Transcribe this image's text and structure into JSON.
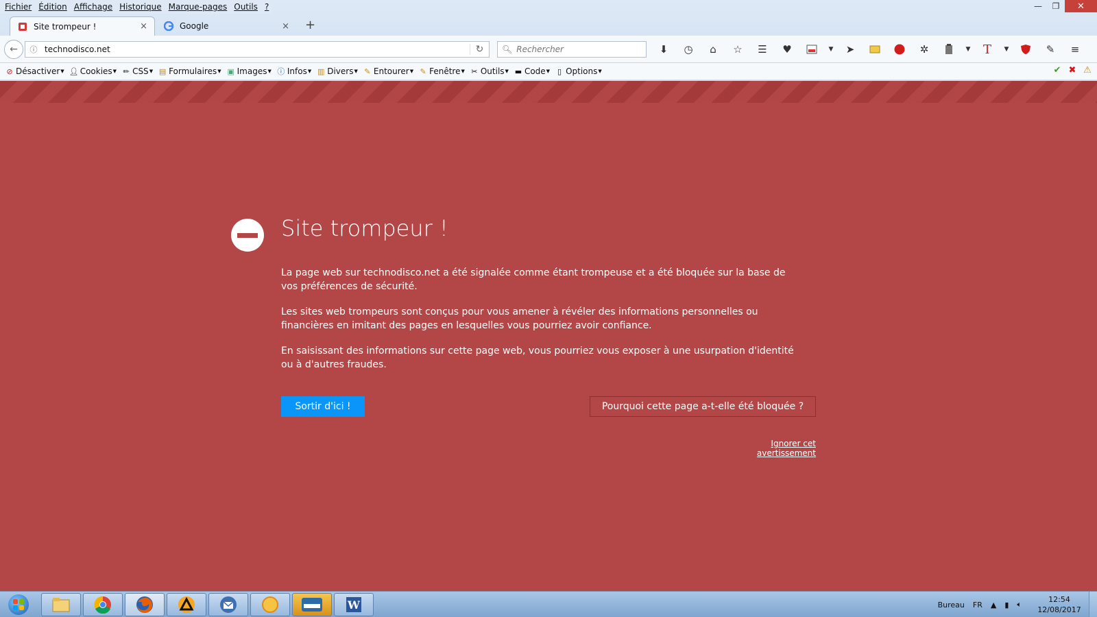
{
  "menubar": {
    "items": [
      "Fichier",
      "Édition",
      "Affichage",
      "Historique",
      "Marque-pages",
      "Outils",
      "?"
    ]
  },
  "window": {
    "minimize": "—",
    "restore": "❐",
    "close": "✕"
  },
  "tabs": [
    {
      "label": "Site trompeur !",
      "close": "×",
      "active": true
    },
    {
      "label": "Google",
      "close": "×",
      "active": false
    }
  ],
  "newtab_label": "+",
  "navbar": {
    "url": "technodisco.net",
    "search_placeholder": "Rechercher"
  },
  "toolbar_icons": [
    "download-icon",
    "history-icon",
    "home-icon",
    "bookmark-star-icon",
    "reader-list-icon",
    "pocket-icon",
    "news-icon",
    "send-icon",
    "screenshot-icon",
    "adblock-icon",
    "puzzle-icon",
    "clipboard-icon",
    "text-t-icon",
    "shield-icon",
    "eyedropper-icon",
    "menu-icon"
  ],
  "devbar": {
    "items": [
      "Désactiver",
      "Cookies",
      "CSS",
      "Formulaires",
      "Images",
      "Infos",
      "Divers",
      "Entourer",
      "Fenêtre",
      "Outils",
      "Code",
      "Options"
    ]
  },
  "page": {
    "title": "Site trompeur !",
    "p1": "La page web sur technodisco.net a été signalée comme étant trompeuse et a été bloquée sur la base de vos préférences de sécurité.",
    "p2": "Les sites web trompeurs sont conçus pour vous amener à révéler des informations personnelles ou financières en imitant des pages en lesquelles vous pourriez avoir confiance.",
    "p3": "En saisissant des informations sur cette page web, vous pourriez vous exposer à une usurpation d'identité ou à d'autres fraudes.",
    "exit_button": "Sortir d'ici !",
    "why_button": "Pourquoi cette page a-t-elle été bloquée ?",
    "ignore_link": "Ignorer cet avertissement"
  },
  "colors": {
    "page_bg": "#b34747",
    "primary_button": "#0996f8"
  },
  "taskbar": {
    "apps": [
      "file-explorer-icon",
      "chrome-icon",
      "firefox-icon",
      "avast-icon",
      "thunderbird-icon",
      "weather-icon",
      "meteo-icon",
      "word-icon"
    ],
    "desktop_label": "Bureau",
    "lang": "FR",
    "time": "12:54",
    "date": "12/08/2017"
  }
}
